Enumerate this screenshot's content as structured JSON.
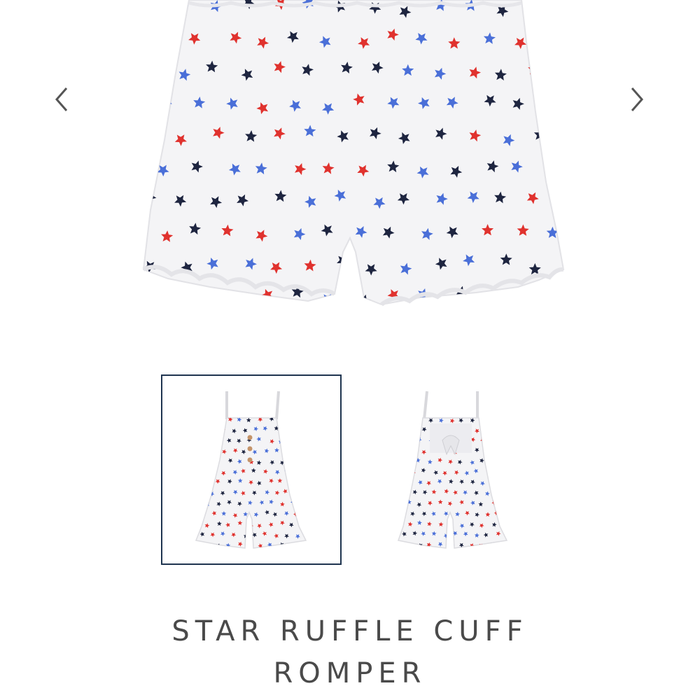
{
  "gallery": {
    "prev_icon": "chevron-left-icon",
    "next_icon": "chevron-right-icon",
    "thumbnails": [
      {
        "label": "front view",
        "selected": true
      },
      {
        "label": "back view",
        "selected": false
      }
    ]
  },
  "product": {
    "title_line1": "STAR RUFFLE CUFF",
    "title_line2": "ROMPER"
  },
  "colors": {
    "star_red": "#e0322e",
    "star_navy": "#1e2540",
    "star_blue": "#4a6fd8",
    "fabric": "#f4f4f6",
    "selected_border": "#1f3550",
    "title_text": "#4a4a4a",
    "arrow": "#555555"
  }
}
